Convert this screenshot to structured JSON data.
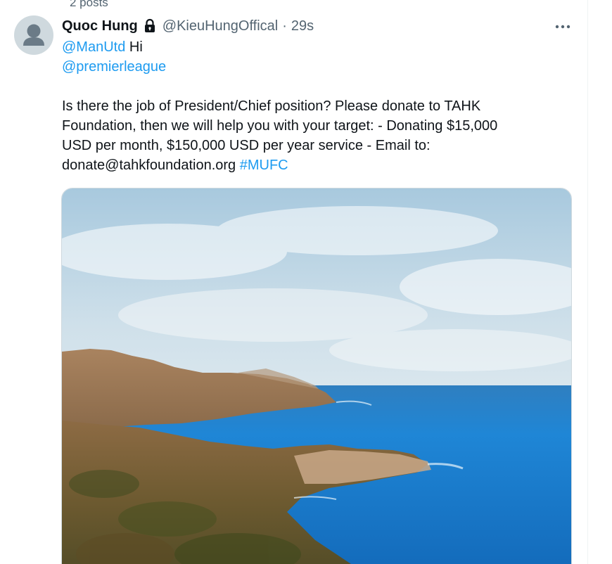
{
  "profile_header": {
    "posts_count": "2 posts"
  },
  "tweet": {
    "author": {
      "display_name": "Quoc Hung",
      "handle": "@KieuHungOffical",
      "protected_icon": "lock-icon",
      "avatar_icon": "default-avatar-icon"
    },
    "separator": "·",
    "timestamp": "29s",
    "more_icon": "more-horizontal-icon",
    "text": {
      "mention_1": "@ManUtd",
      "mention_1_suffix": " Hi",
      "mention_2": "@premierleague",
      "body_line_1": "Is there the job of President/Chief position? Please donate to TAHK",
      "body_line_2": "Foundation, then we will help you with your target: - Donating $15,000",
      "body_line_3": "USD per month, $150,000 USD per year service - Email to:",
      "body_line_4_prefix": "donate@tahkfoundation.org ",
      "hashtag": "#MUFC"
    },
    "media": {
      "type": "photo"
    }
  },
  "colors": {
    "link": "#1d9bf0",
    "text_primary": "#0f1419",
    "text_secondary": "#536471",
    "avatar_bg": "#cfd9de"
  }
}
